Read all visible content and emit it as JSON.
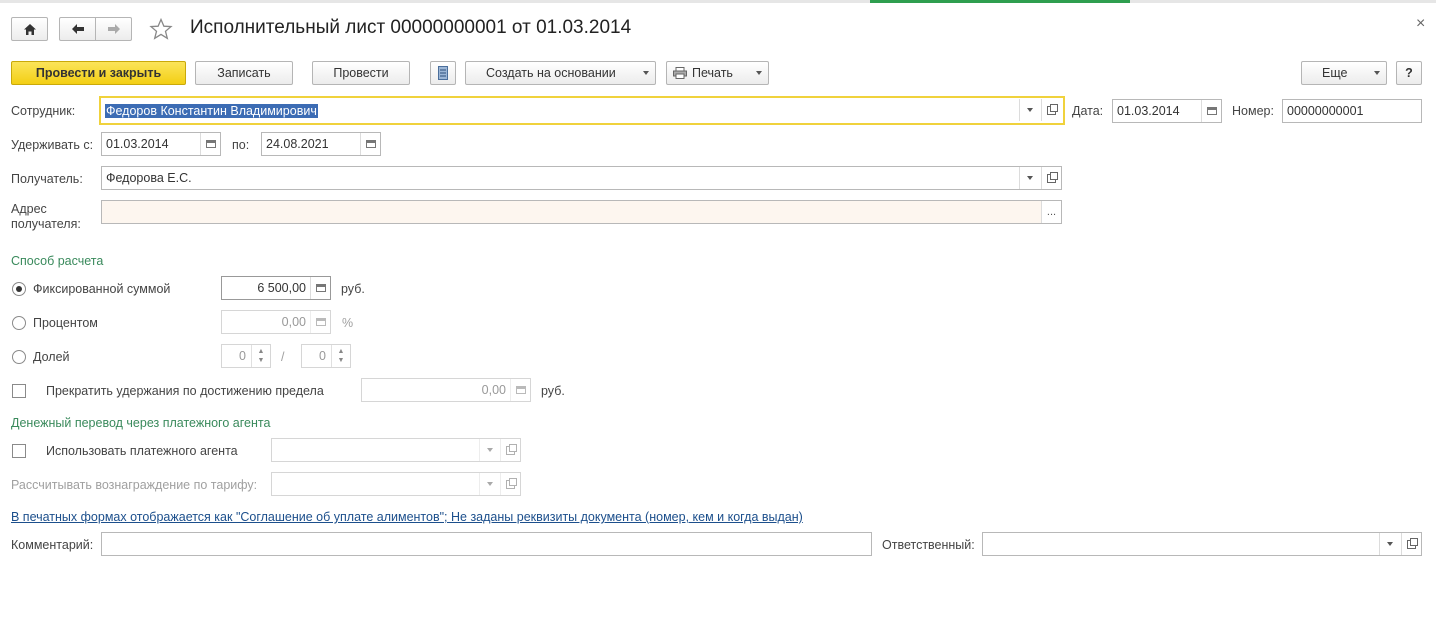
{
  "window": {
    "title": "Исполнительный лист 00000000001 от 01.03.2014",
    "close_glyph": "×"
  },
  "toolbar": {
    "post_and_close": "Провести и закрыть",
    "save": "Записать",
    "post": "Провести",
    "create_based_on": "Создать на основании",
    "print": "Печать",
    "more": "Еще",
    "help": "?"
  },
  "form": {
    "employee_label": "Сотрудник:",
    "employee_value": "Федоров Константин Владимирович",
    "date_label": "Дата:",
    "date_value": "01.03.2014",
    "number_label": "Номер:",
    "number_value": "00000000001",
    "withhold_from_label": "Удерживать с:",
    "withhold_from_value": "01.03.2014",
    "withhold_to_label": "по:",
    "withhold_to_value": "24.08.2021",
    "recipient_label": "Получатель:",
    "recipient_value": "Федорова Е.С.",
    "recipient_address_label_1": "Адрес",
    "recipient_address_label_2": "получателя:",
    "recipient_address_value": "",
    "ellipsis": "..."
  },
  "calc_method": {
    "section_title": "Способ расчета",
    "fixed_label": "Фиксированной суммой",
    "fixed_value": "6 500,00",
    "fixed_unit": "руб.",
    "percent_label": "Процентом",
    "percent_value": "0,00",
    "percent_unit": "%",
    "share_label": "Долей",
    "share_numerator": "0",
    "share_slash": "/",
    "share_denominator": "0",
    "limit_label": "Прекратить удержания по достижению предела",
    "limit_value": "0,00",
    "limit_unit": "руб."
  },
  "agent": {
    "section_title": "Денежный перевод через платежного агента",
    "use_agent_label": "Использовать платежного агента",
    "use_agent_value": "",
    "tariff_label": "Рассчитывать вознаграждение по тарифу:",
    "tariff_value": ""
  },
  "footer": {
    "print_forms_link": "В печатных формах отображается как \"Соглашение об уплате алиментов\"; Не заданы реквизиты документа (номер, кем и когда выдан)",
    "comment_label": "Комментарий:",
    "comment_value": "",
    "responsible_label": "Ответственный:",
    "responsible_value": ""
  }
}
